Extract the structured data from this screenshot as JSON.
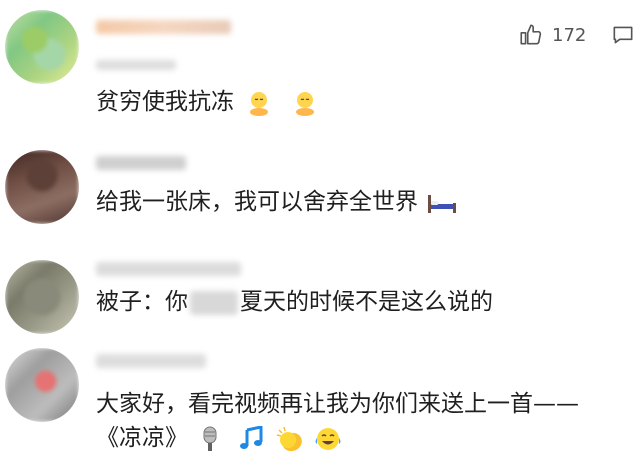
{
  "comments": [
    {
      "id": "c1",
      "text": "贫穷使我抗冻",
      "likes": "172",
      "emoji": [
        "cold-face-emoji",
        "cold-face-emoji"
      ]
    },
    {
      "id": "c2",
      "text": "给我一张床，我可以舍弃全世界",
      "emoji": [
        "bed-emoji"
      ]
    },
    {
      "id": "c3",
      "text_before": "被子：你",
      "text_after": "夏天的时候不是这么说的"
    },
    {
      "id": "c4",
      "line1": "大家好，看完视频再让我为你们来送上一首——",
      "line2": "《凉凉》",
      "emoji": [
        "microphone-emoji",
        "music-note-emoji",
        "clapping-hands-emoji",
        "laughing-tears-emoji"
      ]
    }
  ],
  "colors": {
    "text": "#1f1f1f",
    "meta": "#999999",
    "icon": "#555555"
  }
}
